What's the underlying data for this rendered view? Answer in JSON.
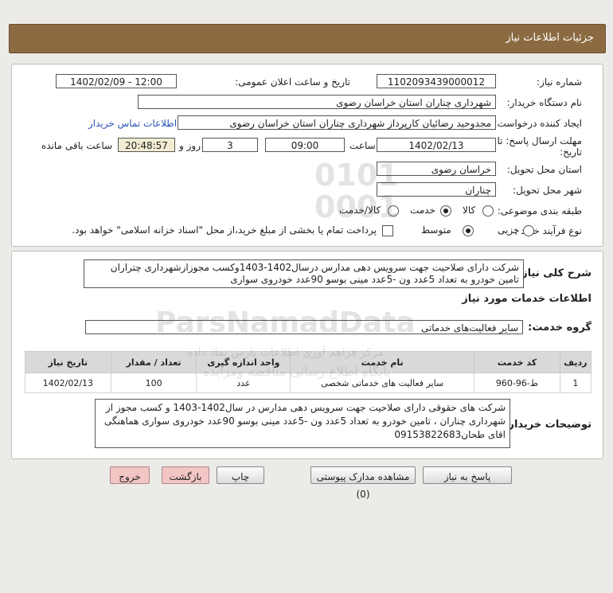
{
  "header": {
    "title": "جزئیات اطلاعات نیاز"
  },
  "need_number": {
    "label": "شماره نیاز:",
    "value": "1102093439000012"
  },
  "announce": {
    "label": "تاریخ و ساعت اعلان عمومی:",
    "value": "1402/02/09 - 12:00"
  },
  "buyer_org": {
    "label": "نام دستگاه خریدار:",
    "value": "شهرداری چناران استان خراسان رضوی"
  },
  "requester": {
    "label": "ایجاد کننده درخواست:",
    "value": "مجدوحید رضائیان کارپرداز شهرداری چناران استان خراسان رضوی",
    "contact_link": "اطلاعات تماس خریدار"
  },
  "deadline": {
    "label_line1": "مهلت ارسال پاسخ: تا",
    "label_line2": "تاریخ:",
    "date": "1402/02/13",
    "time_label": "ساعت",
    "time": "09:00",
    "days": "3",
    "days_label": "روز و",
    "remaining": "20:48:57",
    "remaining_label": "ساعت باقی مانده"
  },
  "province": {
    "label": "استان محل تحویل:",
    "value": "خراسان رضوی"
  },
  "city": {
    "label": "شهر محل تحویل:",
    "value": "چناران"
  },
  "category": {
    "label": "طبقه بندی موضوعی:",
    "options": [
      "کالا",
      "خدمت",
      "کالا/خدمت"
    ],
    "selected": "خدمت"
  },
  "process": {
    "label": "نوع فرآیند خرید :",
    "options": [
      "جزیی",
      "متوسط"
    ],
    "selected": "متوسط",
    "note": "پرداخت تمام یا بخشی از مبلغ خرید،از محل \"اسناد خزانه اسلامی\" خواهد بود."
  },
  "summary": {
    "label": "شرح کلی نیاز:",
    "text": "شرکت دارای صلاحیت جهت سرویس دهی مدارس درسال1402-1403وکسب مجوزازشهرداری چتراران تامین خودرو به تعداد 5عدد ون -5عدد مینی بوسو 90عدد خودروی سواری"
  },
  "services_info": {
    "title": "اطلاعات خدمات مورد نیاز"
  },
  "service_group": {
    "label": "گروه خدمت:",
    "value": "سایر فعالیت‌های خدماتی"
  },
  "table": {
    "headers": [
      "ردیف",
      "کد خدمت",
      "نام خدمت",
      "واحد اندازه گیری",
      "تعداد / مقدار",
      "تاریخ نیاز"
    ],
    "rows": [
      [
        "1",
        "ط-96-960",
        "سایر فعالیت های خدماتی شخصی",
        "عدد",
        "100",
        "1402/02/13"
      ]
    ]
  },
  "buyer_notes": {
    "label": "توضیحات خریدار:",
    "text": "شرکت های حقوقی دارای صلاحیت جهت سرویس دهی مدارس در سال1402-1403 و کسب مجوز از شهرداری چناران ، تامین خودرو به تعداد 5عدد ون -5عدد مینی بوسو 90عدد خودروی سواری هماهنگی اقای طحان09153822683"
  },
  "buttons": {
    "reply": "پاسخ به نیاز",
    "docs": "مشاهده مدارک پیوستی (0)",
    "print": "چاپ",
    "back": "بازگشت",
    "exit": "خروج"
  },
  "watermark": {
    "brand": "ParsNamadData",
    "digits": "0101 0001",
    "tagline": "مرکز فراهم آوری اطلاعات پارس نماد داده",
    "subline": "پایگاه اطلاع رسانی مناقصه ومزایده"
  }
}
